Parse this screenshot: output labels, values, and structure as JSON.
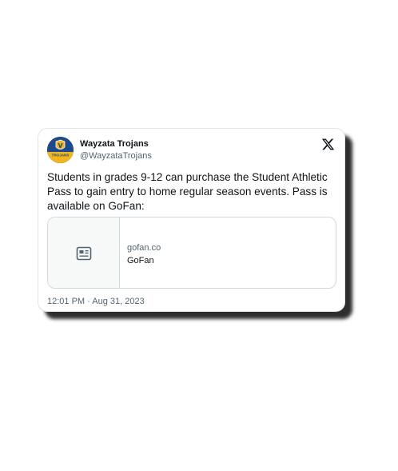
{
  "tweet": {
    "display_name": "Wayzata Trojans",
    "handle": "@WayzataTrojans",
    "avatar_text": "TROJANS",
    "text": "Students in grades 9-12 can purchase the Student Athletic Pass to gain entry to home regular season events. Pass is available on GoFan:",
    "link_card": {
      "domain": "gofan.co",
      "title": "GoFan",
      "thumbnail_icon": "article-icon"
    },
    "timestamp": "12:01 PM · Aug 31, 2023",
    "platform_icon": "x-logo-icon"
  },
  "colors": {
    "text_primary": "#0f1419",
    "text_secondary": "#536471",
    "border": "#cfd9de",
    "avatar_blue": "#1d4a8c",
    "avatar_gold": "#f2b51c"
  }
}
